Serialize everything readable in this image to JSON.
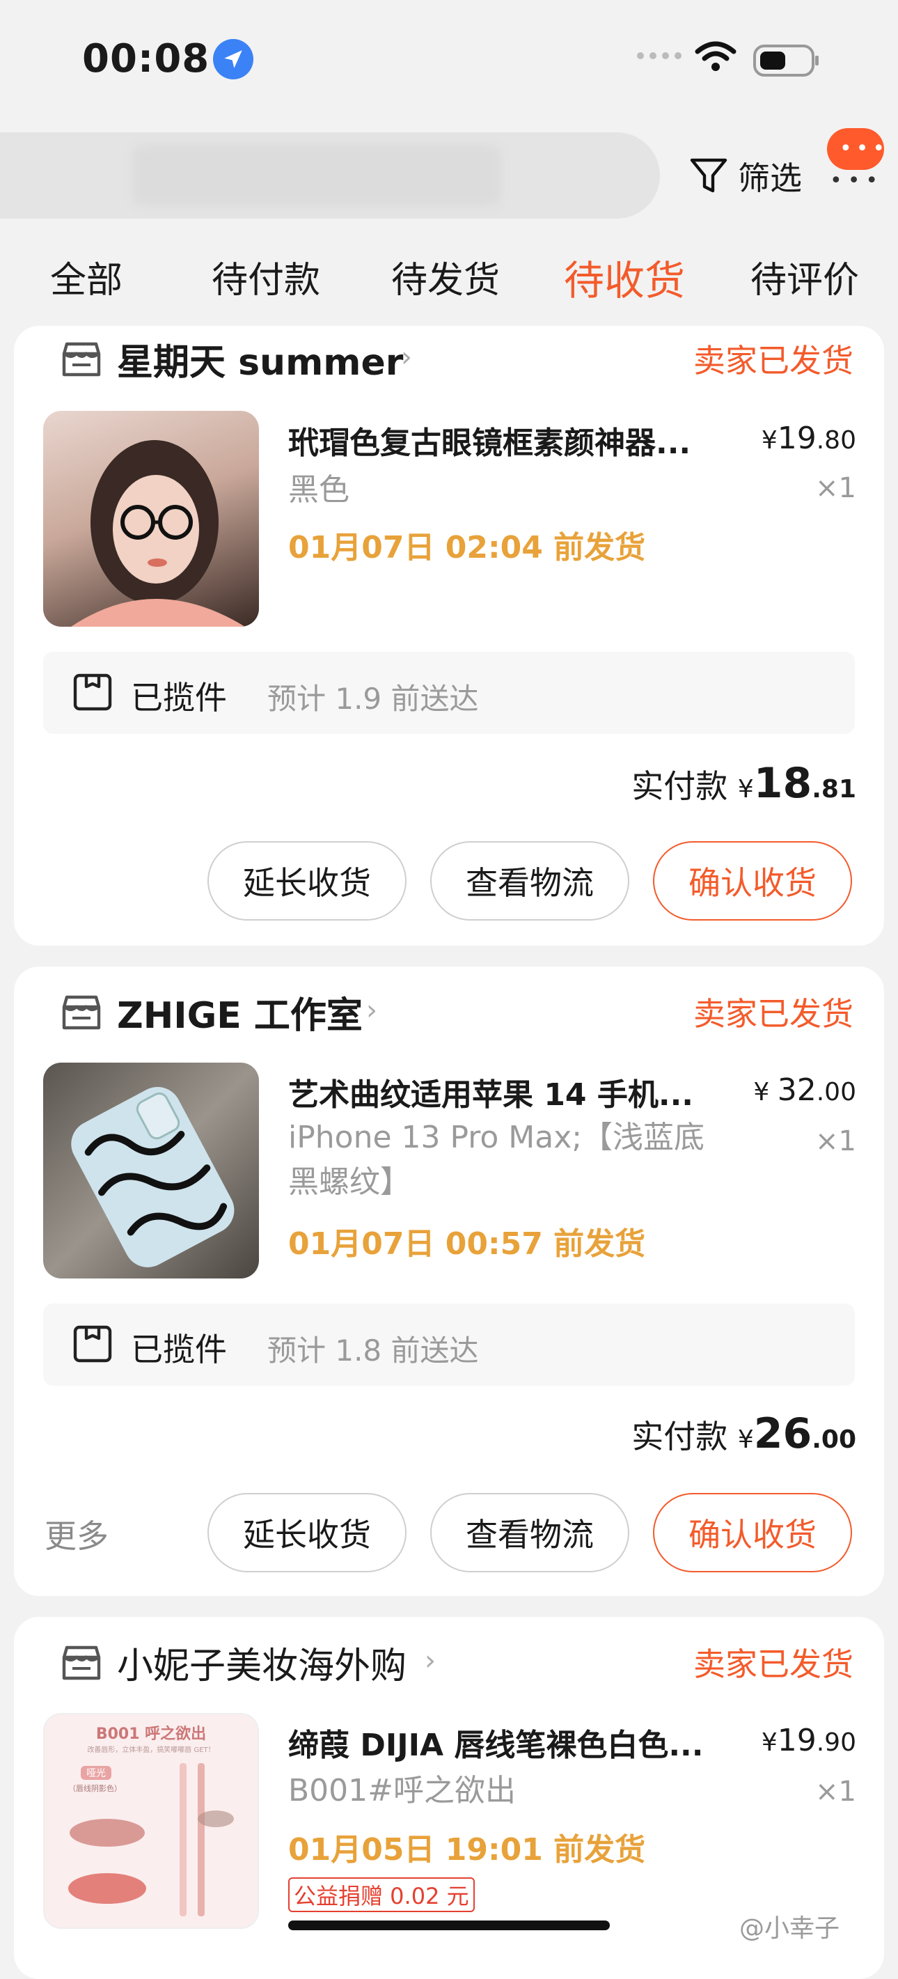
{
  "status_bar": {
    "time": "00:08"
  },
  "filter": {
    "label": "筛选"
  },
  "tabs": [
    "全部",
    "待付款",
    "待发货",
    "待收货",
    "待评价"
  ],
  "active_tab": "待收货",
  "orders": [
    {
      "shop": "星期天 summer",
      "status": "卖家已发货",
      "title": "玳瑁色复古眼镜框素颜神器...",
      "price_int": "19",
      "price_dec": ".80",
      "spec": "黑色",
      "qty": "×1",
      "ship_by": "01月07日 02:04 前发货",
      "logistics_status": "已揽件",
      "logistics_eta": "预计 1.9 前送达",
      "paid_label": "实付款",
      "paid_int": "18",
      "paid_dec": ".81",
      "buttons": [
        "延长收货",
        "查看物流",
        "确认收货"
      ]
    },
    {
      "shop": "ZHIGE 工作室",
      "status": "卖家已发货",
      "title": "艺术曲纹适用苹果 14 手机...",
      "price_int": "32",
      "price_dec": ".00",
      "spec": "iPhone 13 Pro Max;【浅蓝底黑螺纹】",
      "qty": "×1",
      "ship_by": "01月07日 00:57 前发货",
      "logistics_status": "已揽件",
      "logistics_eta": "预计 1.8 前送达",
      "paid_label": "实付款",
      "paid_int": "26",
      "paid_dec": ".00",
      "more": "更多",
      "buttons": [
        "延长收货",
        "查看物流",
        "确认收货"
      ]
    },
    {
      "shop": "小妮子美妆海外购",
      "status": "卖家已发货",
      "title": "缔葭 DIJIA 唇线笔裸色白色...",
      "price_int": "19",
      "price_dec": ".90",
      "spec": "B001#呼之欲出",
      "qty": "×1",
      "ship_by": "01月05日 19:01 前发货",
      "charity": "公益捐赠 0.02 元",
      "thumb_text": "B001 呼之欲出",
      "thumb_sub": "改善唇形，立体丰盈，搞笑嘟嘟唇 GET！",
      "thumb_tag": "哑光",
      "thumb_tag2": "（唇线阴影色）"
    }
  ],
  "currency": "¥",
  "watermark": "@小幸子",
  "colors": {
    "accent": "#f35b2b",
    "ship_time": "#e8a23a",
    "muted": "#9a9a9a"
  }
}
